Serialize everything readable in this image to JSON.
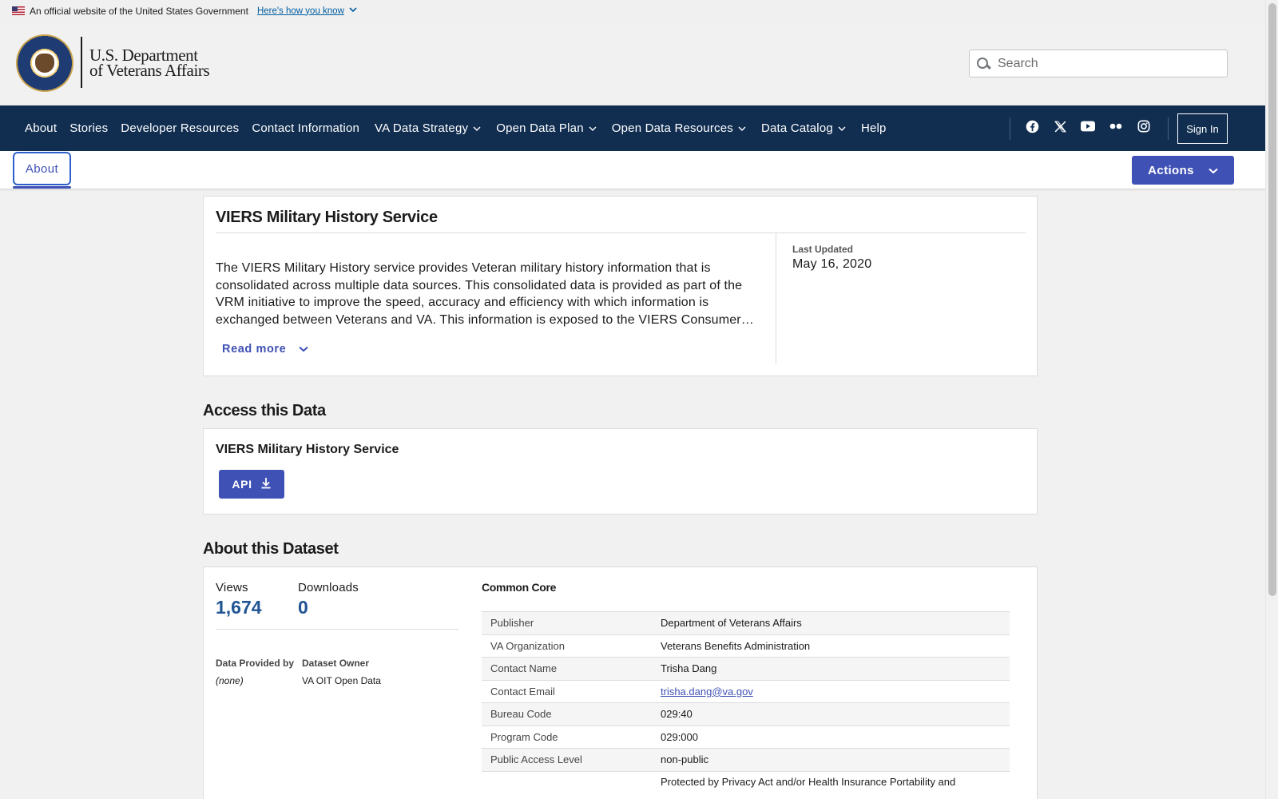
{
  "gov_banner": {
    "official_text": "An official website of the United States Government",
    "how_link": "Here's how you know"
  },
  "header": {
    "brand_line1": "U.S. Department",
    "brand_line2": "of Veterans Affairs",
    "search_placeholder": "Search"
  },
  "nav": {
    "items": [
      {
        "label": "About"
      },
      {
        "label": "Stories"
      },
      {
        "label": "Developer Resources"
      },
      {
        "label": "Contact Information"
      },
      {
        "label": "VA Data Strategy",
        "dropdown": true
      },
      {
        "label": "Open Data Plan",
        "dropdown": true
      },
      {
        "label": "Open Data Resources",
        "dropdown": true
      },
      {
        "label": "Data Catalog",
        "dropdown": true
      },
      {
        "label": "Help"
      }
    ],
    "social_icons": [
      "facebook-icon",
      "x-twitter-icon",
      "youtube-icon",
      "flickr-icon",
      "instagram-icon"
    ],
    "sign_in": "Sign In"
  },
  "tabbar": {
    "active_tab": "About",
    "actions_label": "Actions"
  },
  "dataset": {
    "title": "VIERS Military History Service",
    "description": "The VIERS Military History service provides Veteran military history information that is consolidated across multiple data sources. This consolidated data is provided as part of the VRM initiative to improve the speed, accuracy and efficiency with which information is exchanged between Veterans and VA. This information is exposed to the VIERS Consumer…",
    "read_more": "Read more",
    "last_updated_label": "Last Updated",
    "last_updated_value": "May 16, 2020"
  },
  "access": {
    "heading": "Access this Data",
    "resource_name": "VIERS Military History Service",
    "api_button": "API"
  },
  "about": {
    "heading": "About this Dataset",
    "views_label": "Views",
    "views_value": "1,674",
    "downloads_label": "Downloads",
    "downloads_value": "0",
    "provided_by_label": "Data Provided by",
    "provided_by_value": "(none)",
    "owner_label": "Dataset Owner",
    "owner_value": "VA OIT Open Data",
    "common_core_title": "Common Core",
    "common_core": [
      {
        "key": "Publisher",
        "value": "Department of Veterans Affairs"
      },
      {
        "key": "VA Organization",
        "value": "Veterans Benefits Administration"
      },
      {
        "key": "Contact Name",
        "value": "Trisha Dang"
      },
      {
        "key": "Contact Email",
        "value": "trisha.dang@va.gov",
        "link": true
      },
      {
        "key": "Bureau Code",
        "value": "029:40"
      },
      {
        "key": "Program Code",
        "value": "029:000"
      },
      {
        "key": "Public Access Level",
        "value": "non-public"
      },
      {
        "key": "",
        "value": "Protected by Privacy Act and/or Health Insurance Portability and"
      }
    ]
  },
  "colors": {
    "nav_bg": "#112e51",
    "accent": "#3f51b5",
    "stat_value": "#205493"
  }
}
